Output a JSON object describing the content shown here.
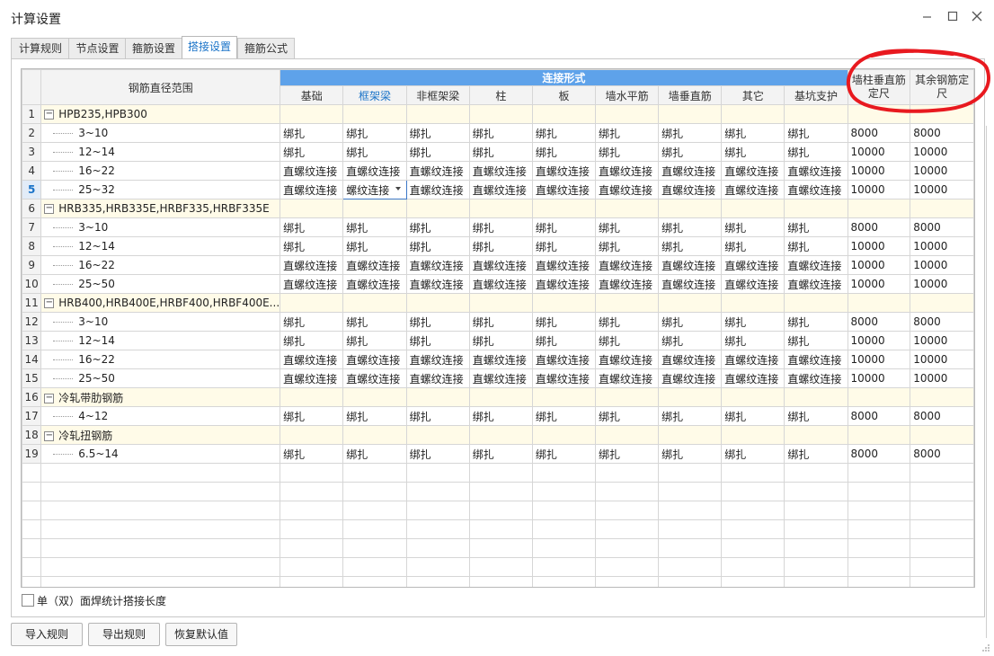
{
  "window": {
    "title": "计算设置",
    "icons": [
      "minimize-icon",
      "maximize-icon",
      "close-icon"
    ]
  },
  "tabs": [
    {
      "label": "计算规则",
      "active": false
    },
    {
      "label": "节点设置",
      "active": false
    },
    {
      "label": "箍筋设置",
      "active": false
    },
    {
      "label": "搭接设置",
      "active": true
    },
    {
      "label": "箍筋公式",
      "active": false
    }
  ],
  "table": {
    "header_range": "钢筋直径范围",
    "header_group": "连接形式",
    "columns": [
      "基础",
      "框架梁",
      "非框架梁",
      "柱",
      "板",
      "墙水平筋",
      "墙垂直筋",
      "其它",
      "基坑支护"
    ],
    "active_column": "框架梁",
    "header_wall_a": "墙柱垂直筋",
    "header_wall_b": "定尺",
    "header_other_a": "其余钢筋定",
    "header_other_b": "尺",
    "rows": [
      {
        "num": "1",
        "type": "group",
        "label": "HPB235,HPB300"
      },
      {
        "num": "2",
        "type": "data",
        "label": "3~10",
        "cells": [
          "绑扎",
          "绑扎",
          "绑扎",
          "绑扎",
          "绑扎",
          "绑扎",
          "绑扎",
          "绑扎",
          "绑扎"
        ],
        "wall": "8000",
        "other": "8000"
      },
      {
        "num": "3",
        "type": "data",
        "label": "12~14",
        "cells": [
          "绑扎",
          "绑扎",
          "绑扎",
          "绑扎",
          "绑扎",
          "绑扎",
          "绑扎",
          "绑扎",
          "绑扎"
        ],
        "wall": "10000",
        "other": "10000"
      },
      {
        "num": "4",
        "type": "data",
        "label": "16~22",
        "cells": [
          "直螺纹连接",
          "直螺纹连接",
          "直螺纹连接",
          "直螺纹连接",
          "直螺纹连接",
          "直螺纹连接",
          "直螺纹连接",
          "直螺纹连接",
          "直螺纹连接"
        ],
        "wall": "10000",
        "other": "10000"
      },
      {
        "num": "5",
        "type": "data",
        "selected": true,
        "label": "25~32",
        "cells": [
          "直螺纹连接",
          "螺纹连接",
          "直螺纹连接",
          "直螺纹连接",
          "直螺纹连接",
          "直螺纹连接",
          "直螺纹连接",
          "直螺纹连接",
          "直螺纹连接"
        ],
        "wall": "10000",
        "other": "10000"
      },
      {
        "num": "6",
        "type": "group",
        "label": "HRB335,HRB335E,HRBF335,HRBF335E"
      },
      {
        "num": "7",
        "type": "data",
        "label": "3~10",
        "cells": [
          "绑扎",
          "绑扎",
          "绑扎",
          "绑扎",
          "绑扎",
          "绑扎",
          "绑扎",
          "绑扎",
          "绑扎"
        ],
        "wall": "8000",
        "other": "8000"
      },
      {
        "num": "8",
        "type": "data",
        "label": "12~14",
        "cells": [
          "绑扎",
          "绑扎",
          "绑扎",
          "绑扎",
          "绑扎",
          "绑扎",
          "绑扎",
          "绑扎",
          "绑扎"
        ],
        "wall": "10000",
        "other": "10000"
      },
      {
        "num": "9",
        "type": "data",
        "label": "16~22",
        "cells": [
          "直螺纹连接",
          "直螺纹连接",
          "直螺纹连接",
          "直螺纹连接",
          "直螺纹连接",
          "直螺纹连接",
          "直螺纹连接",
          "直螺纹连接",
          "直螺纹连接"
        ],
        "wall": "10000",
        "other": "10000"
      },
      {
        "num": "10",
        "type": "data",
        "label": "25~50",
        "cells": [
          "直螺纹连接",
          "直螺纹连接",
          "直螺纹连接",
          "直螺纹连接",
          "直螺纹连接",
          "直螺纹连接",
          "直螺纹连接",
          "直螺纹连接",
          "直螺纹连接"
        ],
        "wall": "10000",
        "other": "10000"
      },
      {
        "num": "11",
        "type": "group",
        "label": "HRB400,HRB400E,HRBF400,HRBF400E..."
      },
      {
        "num": "12",
        "type": "data",
        "label": "3~10",
        "cells": [
          "绑扎",
          "绑扎",
          "绑扎",
          "绑扎",
          "绑扎",
          "绑扎",
          "绑扎",
          "绑扎",
          "绑扎"
        ],
        "wall": "8000",
        "other": "8000"
      },
      {
        "num": "13",
        "type": "data",
        "label": "12~14",
        "cells": [
          "绑扎",
          "绑扎",
          "绑扎",
          "绑扎",
          "绑扎",
          "绑扎",
          "绑扎",
          "绑扎",
          "绑扎"
        ],
        "wall": "10000",
        "other": "10000"
      },
      {
        "num": "14",
        "type": "data",
        "label": "16~22",
        "cells": [
          "直螺纹连接",
          "直螺纹连接",
          "直螺纹连接",
          "直螺纹连接",
          "直螺纹连接",
          "直螺纹连接",
          "直螺纹连接",
          "直螺纹连接",
          "直螺纹连接"
        ],
        "wall": "10000",
        "other": "10000"
      },
      {
        "num": "15",
        "type": "data",
        "label": "25~50",
        "cells": [
          "直螺纹连接",
          "直螺纹连接",
          "直螺纹连接",
          "直螺纹连接",
          "直螺纹连接",
          "直螺纹连接",
          "直螺纹连接",
          "直螺纹连接",
          "直螺纹连接"
        ],
        "wall": "10000",
        "other": "10000"
      },
      {
        "num": "16",
        "type": "group",
        "label": "冷轧带肋钢筋"
      },
      {
        "num": "17",
        "type": "data",
        "label": "4~12",
        "cells": [
          "绑扎",
          "绑扎",
          "绑扎",
          "绑扎",
          "绑扎",
          "绑扎",
          "绑扎",
          "绑扎",
          "绑扎"
        ],
        "wall": "8000",
        "other": "8000"
      },
      {
        "num": "18",
        "type": "group",
        "label": "冷轧扭钢筋"
      },
      {
        "num": "19",
        "type": "data",
        "label": "6.5~14",
        "cells": [
          "绑扎",
          "绑扎",
          "绑扎",
          "绑扎",
          "绑扎",
          "绑扎",
          "绑扎",
          "绑扎",
          "绑扎"
        ],
        "wall": "8000",
        "other": "8000"
      }
    ]
  },
  "checkbox": {
    "label": "单（双）面焊统计搭接长度",
    "checked": false
  },
  "buttons": {
    "import": "导入规则",
    "export": "导出规则",
    "restore": "恢复默认值"
  },
  "colors": {
    "header_group": "#5ea2ea",
    "accent": "#1a73c8",
    "group_row": "#fffbe8",
    "annotation": "#e8191f"
  }
}
